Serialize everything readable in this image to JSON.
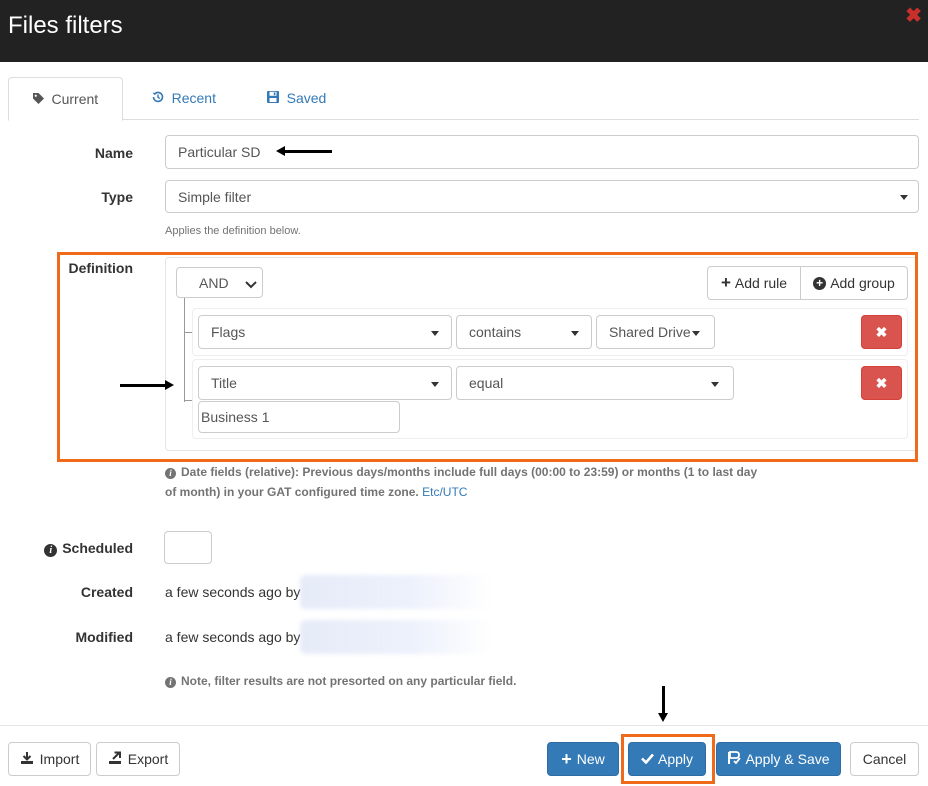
{
  "dialog": {
    "title": "Files filters",
    "close_glyph": "✖"
  },
  "tabs": [
    {
      "label": "Current",
      "icon": "tag-icon",
      "active": true
    },
    {
      "label": "Recent",
      "icon": "history-icon",
      "active": false
    },
    {
      "label": "Saved",
      "icon": "floppy-disk-icon",
      "active": false
    }
  ],
  "form": {
    "name_label": "Name",
    "name_value": "Particular SD",
    "type_label": "Type",
    "type_value": "Simple filter",
    "type_help": "Applies the definition below.",
    "definition_label": "Definition"
  },
  "query": {
    "condition": "AND",
    "add_rule_label": "Add rule",
    "add_group_label": "Add group",
    "rules": [
      {
        "field": "Flags",
        "operator": "contains",
        "value": "Shared Drive"
      },
      {
        "field": "Title",
        "operator": "equal",
        "value": "Business 1"
      }
    ],
    "delete_glyph": "✖"
  },
  "date_info": {
    "text_line1": "Date fields (relative): Previous days/months include full days (00:00 to 23:59) or months (1 to last day",
    "text_line2": "of month) in your GAT configured time zone.",
    "timezone": "Etc/UTC"
  },
  "meta": {
    "scheduled_label": "Scheduled",
    "created_label": "Created",
    "created_value": "a few seconds ago by",
    "modified_label": "Modified",
    "modified_value": "a few seconds ago by"
  },
  "note": "Note, filter results are not presorted on any particular field.",
  "footer": {
    "import_label": "Import",
    "export_label": "Export",
    "new_label": "New",
    "apply_label": "Apply",
    "apply_save_label": "Apply & Save",
    "cancel_label": "Cancel"
  },
  "colors": {
    "header_bg": "#222222",
    "highlight": "#f06a1c",
    "primary": "#337ab7",
    "danger": "#d9534f",
    "close": "#c9302c"
  }
}
